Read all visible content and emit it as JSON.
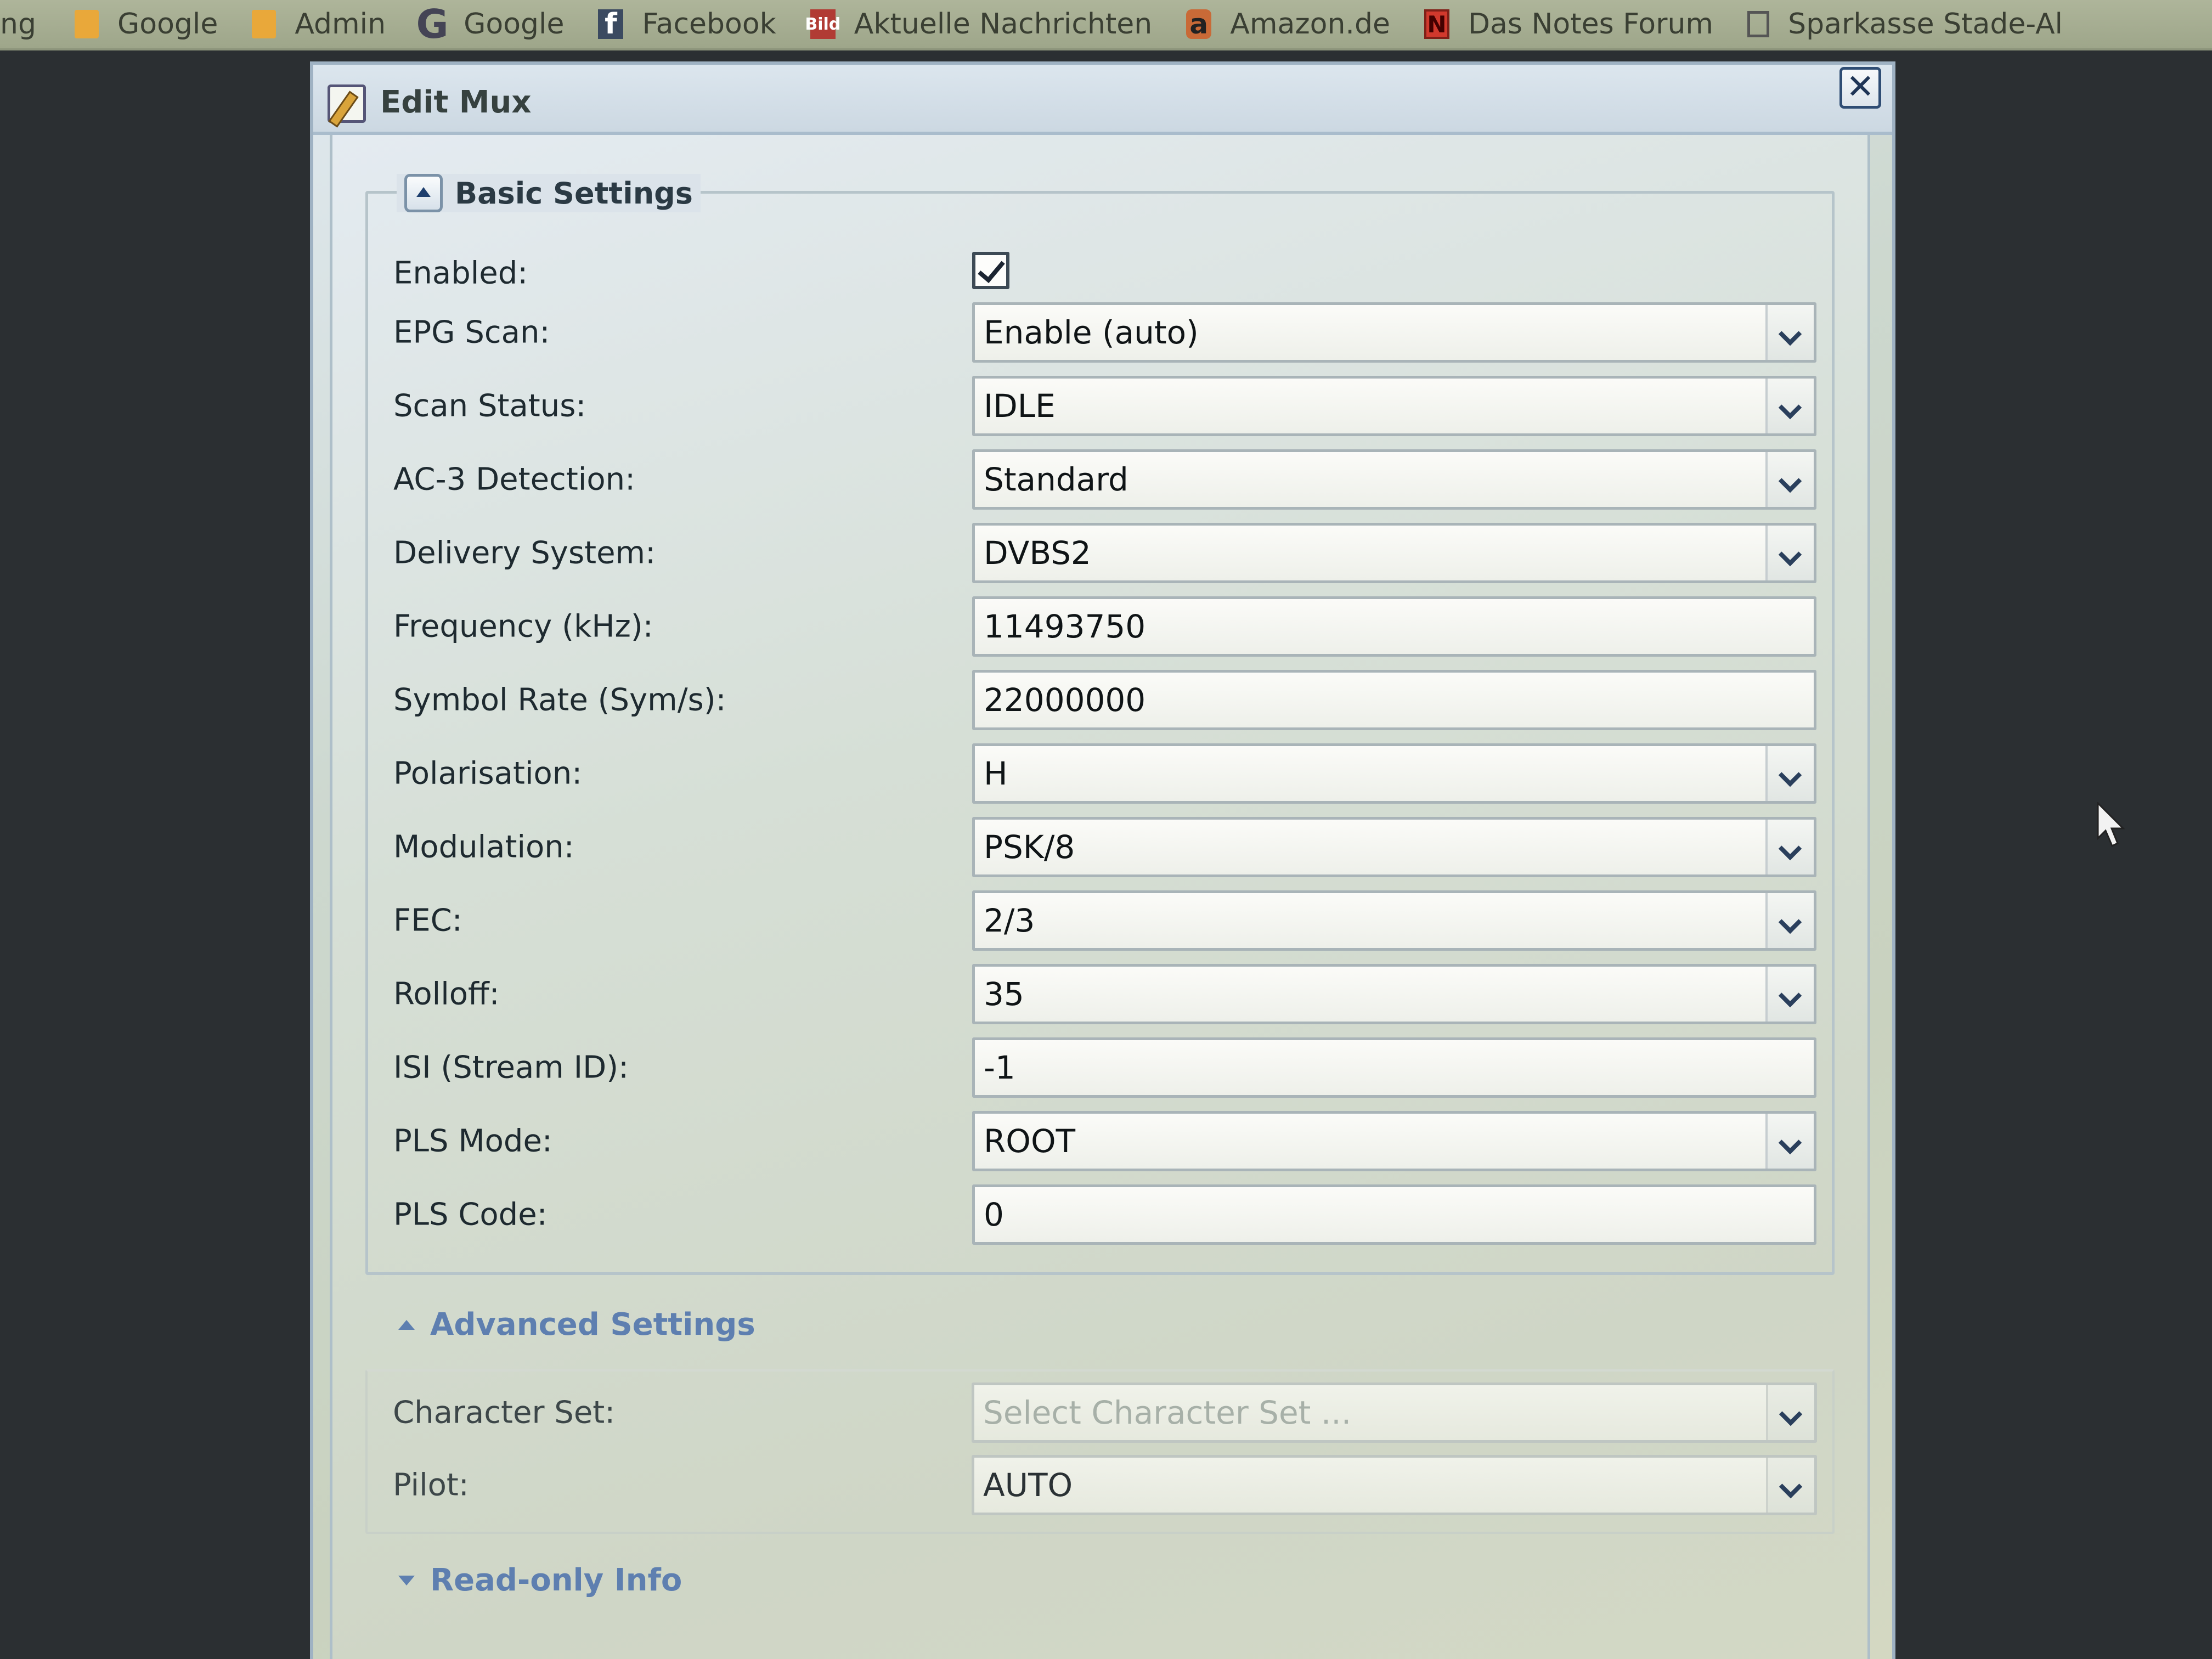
{
  "bookmarks": [
    {
      "label": "ng",
      "icon": "none"
    },
    {
      "label": "Google",
      "icon": "folder-icon"
    },
    {
      "label": "Admin",
      "icon": "folder-icon"
    },
    {
      "label": "Google",
      "icon": "google-icon"
    },
    {
      "label": "Facebook",
      "icon": "facebook-icon"
    },
    {
      "label": "Aktuelle Nachrichten",
      "icon": "bild-icon"
    },
    {
      "label": "Amazon.de",
      "icon": "amazon-icon"
    },
    {
      "label": "Das Notes Forum",
      "icon": "notes-icon"
    },
    {
      "label": "Sparkasse Stade-Al",
      "icon": "page-icon"
    }
  ],
  "icons": {
    "facebook": "f",
    "bild": "Bild",
    "amazon": "a",
    "notes": "N",
    "google": "G"
  },
  "dialog": {
    "title": "Edit Mux",
    "close_glyph": "✕"
  },
  "basic": {
    "legend": "Basic Settings",
    "enabled": {
      "label": "Enabled:",
      "checked": true
    },
    "epg_scan": {
      "label": "EPG Scan:",
      "value": "Enable (auto)"
    },
    "scan_status": {
      "label": "Scan Status:",
      "value": "IDLE"
    },
    "ac3": {
      "label": "AC-3 Detection:",
      "value": "Standard"
    },
    "delivery": {
      "label": "Delivery System:",
      "value": "DVBS2"
    },
    "frequency": {
      "label": "Frequency (kHz):",
      "value": "11493750"
    },
    "symbol_rate": {
      "label": "Symbol Rate (Sym/s):",
      "value": "22000000"
    },
    "polarisation": {
      "label": "Polarisation:",
      "value": "H"
    },
    "modulation": {
      "label": "Modulation:",
      "value": "PSK/8"
    },
    "fec": {
      "label": "FEC:",
      "value": "2/3"
    },
    "rolloff": {
      "label": "Rolloff:",
      "value": "35"
    },
    "isi": {
      "label": "ISI (Stream ID):",
      "value": "-1"
    },
    "pls_mode": {
      "label": "PLS Mode:",
      "value": "ROOT"
    },
    "pls_code": {
      "label": "PLS Code:",
      "value": "0"
    }
  },
  "advanced": {
    "header": "Advanced Settings",
    "charset": {
      "label": "Character Set:",
      "placeholder": "Select Character Set ..."
    },
    "pilot": {
      "label": "Pilot:",
      "value": "AUTO"
    }
  },
  "readonly": {
    "header": "Read-only Info"
  }
}
